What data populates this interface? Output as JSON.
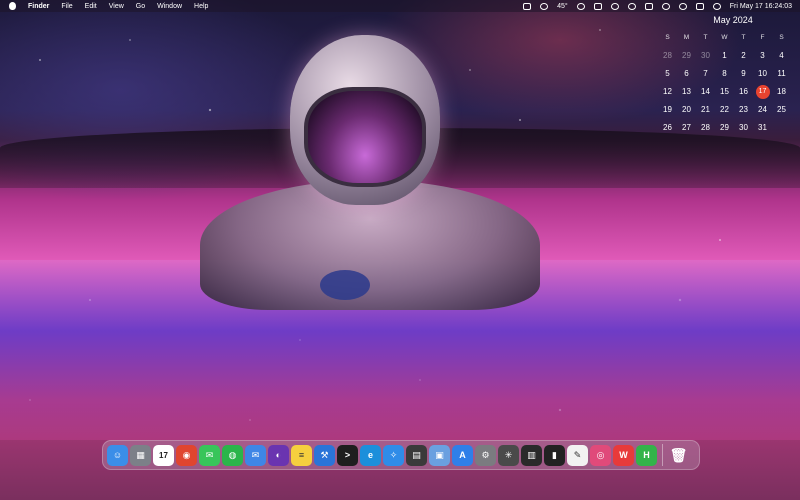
{
  "menubar": {
    "app_name": "Finder",
    "menus": [
      "File",
      "Edit",
      "View",
      "Go",
      "Window",
      "Help"
    ],
    "temperature": "45°",
    "datetime": "Fri May 17  16:24:03"
  },
  "calendar": {
    "title": "May 2024",
    "weekdays": [
      "S",
      "M",
      "T",
      "W",
      "T",
      "F",
      "S"
    ],
    "weeks": [
      [
        "28",
        "29",
        "30",
        "1",
        "2",
        "3",
        "4"
      ],
      [
        "5",
        "6",
        "7",
        "8",
        "9",
        "10",
        "11"
      ],
      [
        "12",
        "13",
        "14",
        "15",
        "16",
        "17",
        "18"
      ],
      [
        "19",
        "20",
        "21",
        "22",
        "23",
        "24",
        "25"
      ],
      [
        "26",
        "27",
        "28",
        "29",
        "30",
        "31",
        ""
      ]
    ],
    "today": "17"
  },
  "dock": {
    "calendar_tile_day": "17",
    "apps": [
      {
        "name": "finder",
        "glyph": "☺",
        "color": "#3b8ee8"
      },
      {
        "name": "launchpad",
        "glyph": "▦",
        "color": "#7c8088"
      },
      {
        "name": "calendar",
        "glyph": "",
        "color": "#ffffff"
      },
      {
        "name": "chrome",
        "glyph": "◉",
        "color": "#e0452f"
      },
      {
        "name": "messages",
        "glyph": "✉",
        "color": "#38c55a"
      },
      {
        "name": "wechat",
        "glyph": "◍",
        "color": "#2bb54a"
      },
      {
        "name": "mail",
        "glyph": "✉",
        "color": "#3e86e6"
      },
      {
        "name": "github",
        "glyph": "◐",
        "color": "#6a34b0"
      },
      {
        "name": "notes",
        "glyph": "≡",
        "color": "#f5cf3e"
      },
      {
        "name": "xcode",
        "glyph": "⚒",
        "color": "#2a74d8"
      },
      {
        "name": "terminal",
        "glyph": ">",
        "color": "#1e1e1e"
      },
      {
        "name": "edge",
        "glyph": "e",
        "color": "#1c8fdb"
      },
      {
        "name": "safari",
        "glyph": "✧",
        "color": "#2f8ce8"
      },
      {
        "name": "calculator",
        "glyph": "▤",
        "color": "#3a3a3a"
      },
      {
        "name": "preview",
        "glyph": "▣",
        "color": "#6aa0e0"
      },
      {
        "name": "app-store",
        "glyph": "A",
        "color": "#2f7fe8"
      },
      {
        "name": "system-settings",
        "glyph": "⚙",
        "color": "#7b7b80"
      },
      {
        "name": "chatgpt",
        "glyph": "✳",
        "color": "#4a4a4a"
      },
      {
        "name": "piano",
        "glyph": "▥",
        "color": "#2a2a2a"
      },
      {
        "name": "console",
        "glyph": "▮",
        "color": "#222222"
      },
      {
        "name": "textedit",
        "glyph": "✎",
        "color": "#f2f2f2"
      },
      {
        "name": "browser",
        "glyph": "◎",
        "color": "#e04a7a"
      },
      {
        "name": "wps",
        "glyph": "W",
        "color": "#e83a3a"
      },
      {
        "name": "hbuilder",
        "glyph": "H",
        "color": "#33b34a"
      }
    ],
    "trash_glyph": "🗑"
  }
}
